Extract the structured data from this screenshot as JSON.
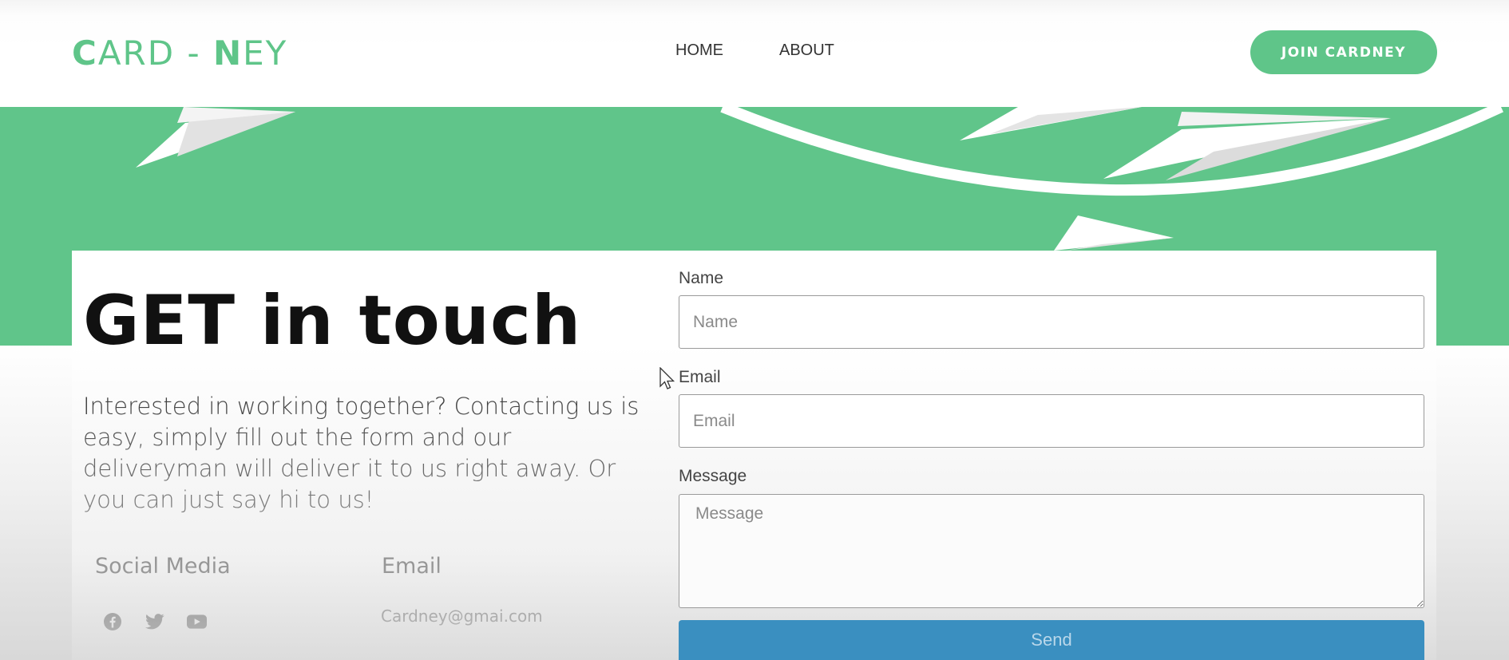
{
  "brand": {
    "logo_part1": "C",
    "logo_part2": "ARD",
    "logo_dash": " - ",
    "logo_part3": "N",
    "logo_part4": "EY",
    "accent_color": "#60c58a"
  },
  "nav": {
    "items": [
      {
        "label": "HOME"
      },
      {
        "label": "ABOUT"
      }
    ],
    "cta_label": "JOIN CARDNEY"
  },
  "hero": {
    "headline": "GET in touch",
    "intro": "Interested in working together? Contacting us is easy, simply fill out the form and our deliveryman will deliver it to us right away. Or you can just say hi to us!"
  },
  "contact": {
    "social_heading": "Social Media",
    "social_icons": [
      "facebook-icon",
      "twitter-icon",
      "youtube-icon"
    ],
    "email_heading": "Email",
    "email_address": "Cardney@gmai.com"
  },
  "form": {
    "name_label": "Name",
    "name_placeholder": "Name",
    "email_label": "Email",
    "email_placeholder": "Email",
    "message_label": "Message",
    "message_placeholder": "Message",
    "send_label": "Send",
    "send_color": "#3a8fc0"
  }
}
